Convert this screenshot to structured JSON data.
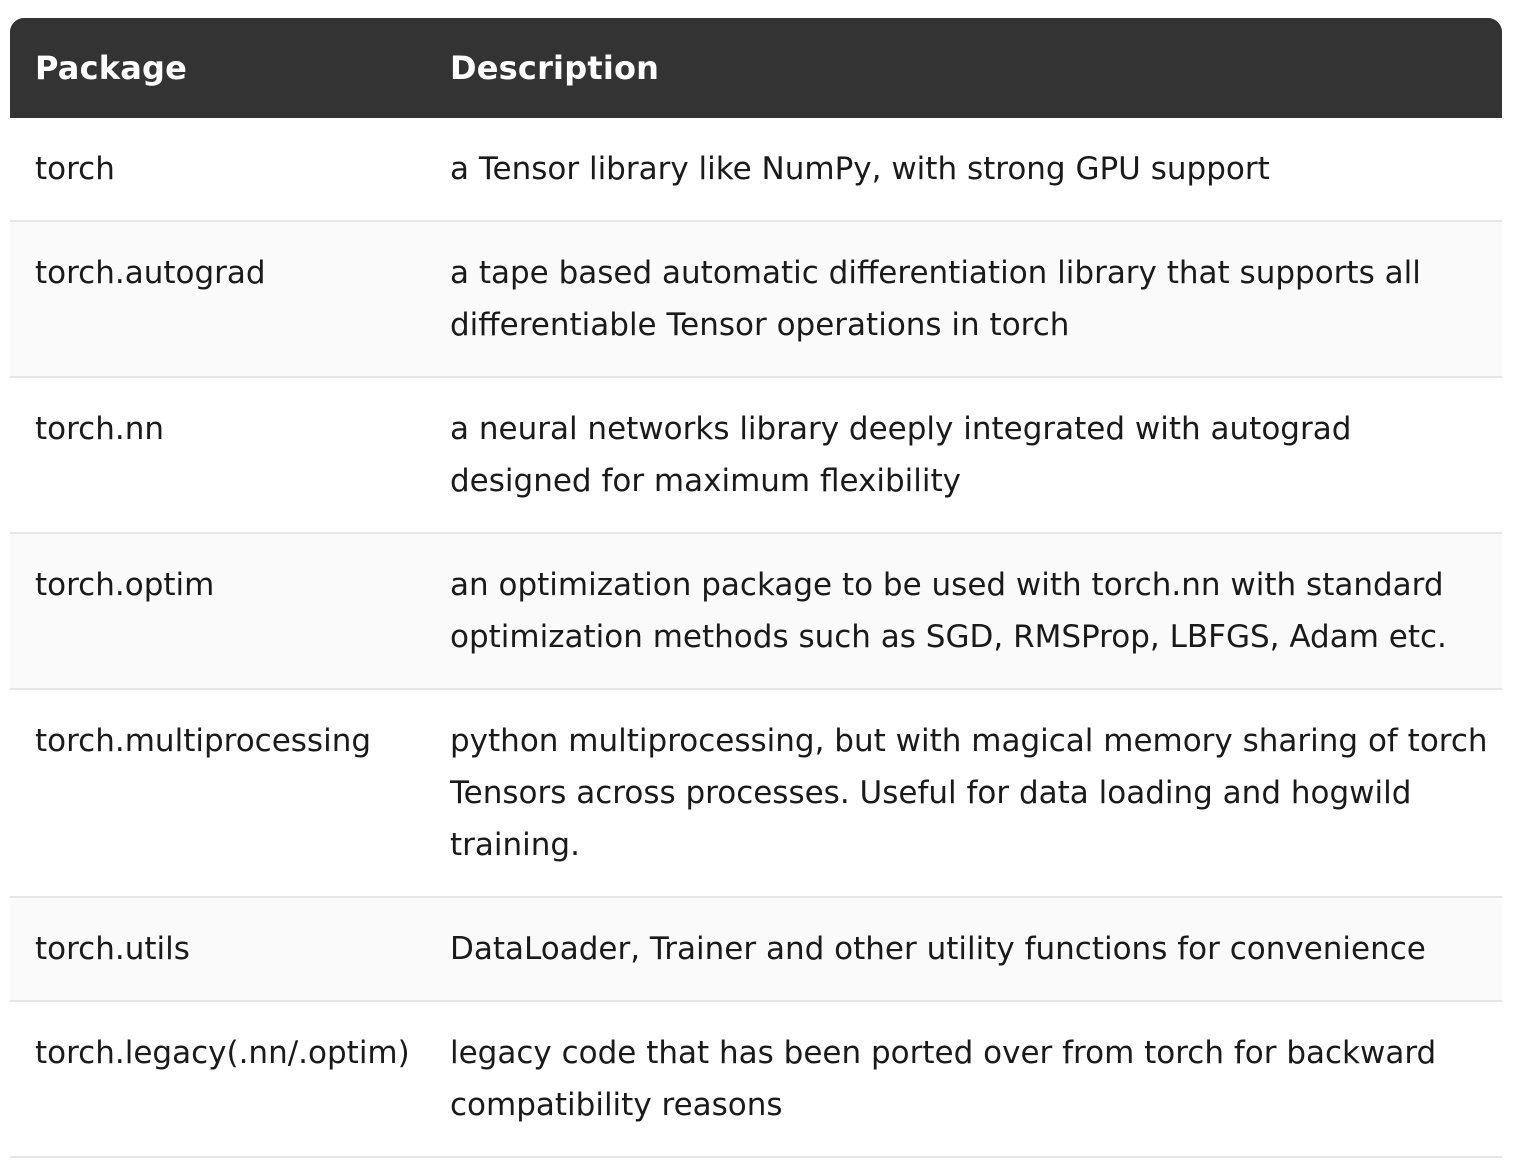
{
  "table": {
    "headers": {
      "package": "Package",
      "description": "Description"
    },
    "rows": [
      {
        "package": "torch",
        "description": "a Tensor library like NumPy, with strong GPU support"
      },
      {
        "package": "torch.autograd",
        "description": "a tape based automatic differentiation library that supports all differentiable Tensor operations in torch"
      },
      {
        "package": "torch.nn",
        "description": "a neural networks library deeply integrated with autograd designed for maximum flexibility"
      },
      {
        "package": "torch.optim",
        "description": "an optimization package to be used with torch.nn with standard optimization methods such as SGD, RMSProp, LBFGS, Adam etc."
      },
      {
        "package": "torch.multiprocessing",
        "description": "python multiprocessing, but with magical memory sharing of torch Tensors across processes. Useful for data loading and hogwild training."
      },
      {
        "package": "torch.utils",
        "description": "DataLoader, Trainer and other utility functions for convenience"
      },
      {
        "package": "torch.legacy(.nn/.optim)",
        "description": "legacy code that has been ported over from torch for backward compatibility reasons"
      }
    ]
  }
}
